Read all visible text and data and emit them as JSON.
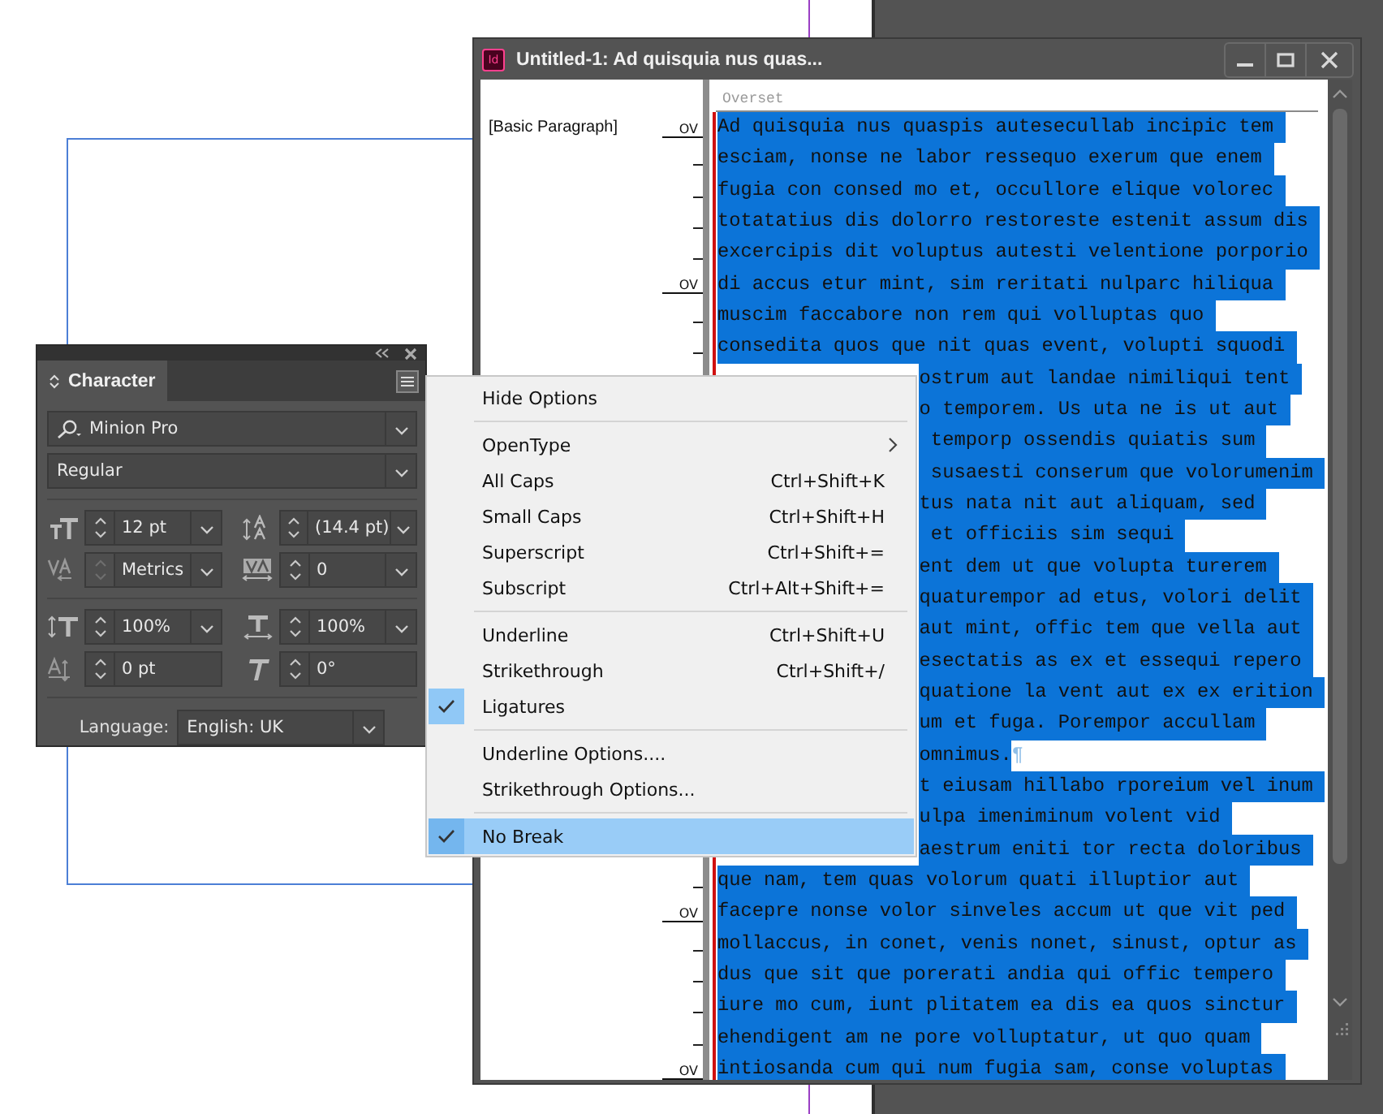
{
  "story_window": {
    "app_badge": "Id",
    "title": "Untitled-1: Ad quisquia nus quas...",
    "overset_label": "Overset",
    "selected": true,
    "lines": [
      {
        "text": "Ad quisquia nus quaspis autesecullab incipic tem ",
        "style": "[Basic Paragraph]",
        "marker": "OV",
        "covered": false
      },
      {
        "text": "esciam, nonse ne labor ressequo exerum que enem ",
        "covered": false
      },
      {
        "text": "fugia con consed mo et, occullore elique volorec ",
        "covered": false
      },
      {
        "text": "totatatius dis dolorro restoreste estenit assum dis ",
        "covered": false
      },
      {
        "text": "excercipis dit voluptus autesti velentione porporio ",
        "covered": false
      },
      {
        "text": "di accus etur mint, sim reritati nulparc hiliqua ",
        "marker": "OV",
        "covered": false
      },
      {
        "text": "muscim faccabore non rem qui volluptas quo ",
        "covered": false
      },
      {
        "text": "consedita quos que nit quas event, volupti squodi ",
        "covered": false
      },
      {
        "text": "ostrum aut landae nimiliqui tent ",
        "covered": true
      },
      {
        "text": "o temporem. Us uta ne is ut aut ",
        "covered": true
      },
      {
        "text": " temporp ossendis quiatis sum ",
        "covered": true
      },
      {
        "text": " susaesti conserum que volorumenim ",
        "covered": true
      },
      {
        "text": "tus nata nit aut aliquam, sed ",
        "covered": true
      },
      {
        "text": " et officiis sim sequi ",
        "covered": true
      },
      {
        "text": "ent dem ut que volupta turerem ",
        "covered": true
      },
      {
        "text": "quaturempor ad etus, volori delit ",
        "covered": true
      },
      {
        "text": "aut mint, offic tem que vella aut ",
        "covered": true
      },
      {
        "text": "esectatis as ex et essequi repero ",
        "covered": true
      },
      {
        "text": "quatione la vent aut ex ex erition ",
        "covered": true
      },
      {
        "text": "um et fuga. Porempor accullam ",
        "covered": true
      },
      {
        "text": "omnimus.",
        "end_mark": "¶",
        "covered": true
      },
      {
        "text": "t eiusam hillabo rporeium vel inum ",
        "covered": true
      },
      {
        "text": "ulpa imeniminum volent vid ",
        "covered": true
      },
      {
        "text": "aestrum eniti tor recta doloribus ",
        "covered": true
      },
      {
        "text": "que nam, tem quas volorum quati illuptior aut ",
        "covered": false
      },
      {
        "text": "facepre nonse volor sinveles accum ut que vit ped ",
        "marker": "OV",
        "covered": false
      },
      {
        "text": "mollaccus, in conet, venis nonet, sinust, optur as ",
        "covered": false
      },
      {
        "text": "dus que sit que porerati andia qui offic tempero ",
        "covered": false
      },
      {
        "text": "iure mo cum, iunt plitatem ea dis ea quos sinctur ",
        "covered": false
      },
      {
        "text": "ehendigent am ne pore volluptatur, ut quo quam ",
        "covered": false
      },
      {
        "text": "intiosanda cum qui num fugia sam, conse voluptas ",
        "marker": "OV",
        "covered": false
      }
    ]
  },
  "character_panel": {
    "tab": "Character",
    "font": "Minion Pro",
    "style": "Regular",
    "fields": [
      {
        "value": "12 pt",
        "dropdown": true,
        "spinner_disabled": false
      },
      {
        "value": "(14.4 pt)",
        "dropdown": true,
        "spinner_disabled": false
      },
      {
        "value": "Metrics",
        "dropdown": true,
        "spinner_disabled": true
      },
      {
        "value": "0",
        "dropdown": true,
        "spinner_disabled": false
      },
      {
        "value": "100%",
        "dropdown": true,
        "spinner_disabled": false
      },
      {
        "value": "100%",
        "dropdown": true,
        "spinner_disabled": false
      },
      {
        "value": "0 pt",
        "dropdown": false,
        "spinner_disabled": false
      },
      {
        "value": "0°",
        "dropdown": false,
        "spinner_disabled": false
      }
    ],
    "language_label": "Language:",
    "language": "English: UK"
  },
  "menu": [
    {
      "kind": "item",
      "label": "Hide Options",
      "checked": false,
      "selected": false
    },
    {
      "kind": "separator"
    },
    {
      "kind": "item",
      "label": "OpenType",
      "submenu": true,
      "checked": false,
      "selected": false
    },
    {
      "kind": "item",
      "label": "All Caps",
      "shortcut": "Ctrl+Shift+K",
      "checked": false,
      "selected": false
    },
    {
      "kind": "item",
      "label": "Small Caps",
      "shortcut": "Ctrl+Shift+H",
      "checked": false,
      "selected": false
    },
    {
      "kind": "item",
      "label": "Superscript",
      "shortcut": "Ctrl+Shift+=",
      "checked": false,
      "selected": false
    },
    {
      "kind": "item",
      "label": "Subscript",
      "shortcut": "Ctrl+Alt+Shift+=",
      "checked": false,
      "selected": false
    },
    {
      "kind": "separator"
    },
    {
      "kind": "item",
      "label": "Underline",
      "shortcut": "Ctrl+Shift+U",
      "checked": false,
      "selected": false
    },
    {
      "kind": "item",
      "label": "Strikethrough",
      "shortcut": "Ctrl+Shift+/",
      "checked": false,
      "selected": false
    },
    {
      "kind": "item",
      "label": "Ligatures",
      "checked": true,
      "selected": false
    },
    {
      "kind": "separator"
    },
    {
      "kind": "item",
      "label": "Underline Options....",
      "checked": false,
      "selected": false
    },
    {
      "kind": "item",
      "label": "Strikethrough Options...",
      "checked": false,
      "selected": false
    },
    {
      "kind": "separator"
    },
    {
      "kind": "item",
      "label": "No Break",
      "checked": true,
      "selected": true
    }
  ]
}
